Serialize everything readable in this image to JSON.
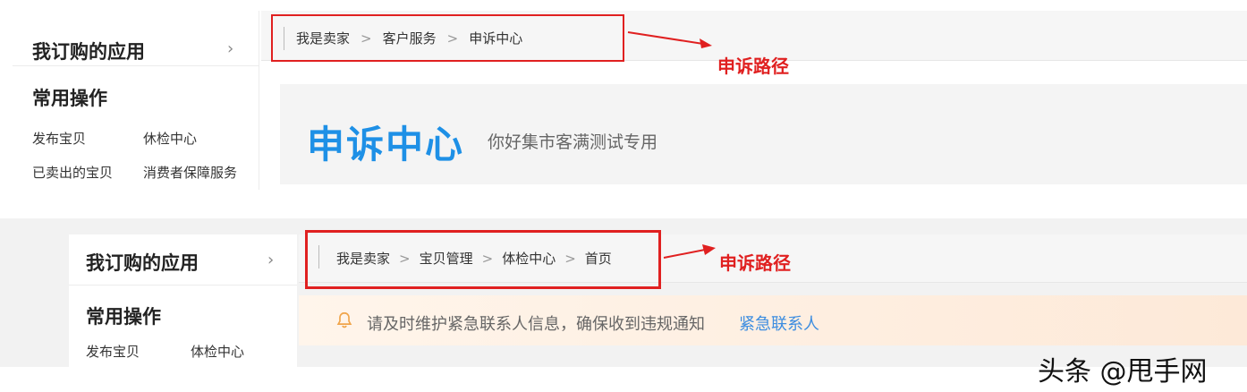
{
  "panel1": {
    "sidebar": {
      "my_apps": "我订购的应用",
      "chevron": "›",
      "common_ops": "常用操作",
      "links": [
        "发布宝贝",
        "休检中心",
        "已卖出的宝贝",
        "消费者保障服务"
      ]
    },
    "breadcrumb": [
      "我是卖家",
      "客户服务",
      "申诉中心"
    ],
    "separator": ">",
    "title": "申诉中心",
    "subtitle": "你好集市客满测试专用",
    "annotation": "申诉路径"
  },
  "panel2": {
    "sidebar": {
      "my_apps": "我订购的应用",
      "chevron": "›",
      "common_ops": "常用操作",
      "links": [
        "发布宝贝",
        "体检中心"
      ]
    },
    "breadcrumb": [
      "我是卖家",
      "宝贝管理",
      "体检中心",
      "首页"
    ],
    "separator": ">",
    "notice": "请及时维护紧急联系人信息，确保收到违规通知",
    "notice_link": "紧急联系人",
    "annotation": "申诉路径"
  },
  "watermark": "头条 @甩手网",
  "colors": {
    "highlight_red": "#e02020",
    "title_blue": "#1e90e6",
    "link_blue": "#3d8de0"
  },
  "icons": {
    "chevron": "chevron-right-icon",
    "notice": "bell-icon",
    "arrow": "red-arrow-annotation"
  }
}
